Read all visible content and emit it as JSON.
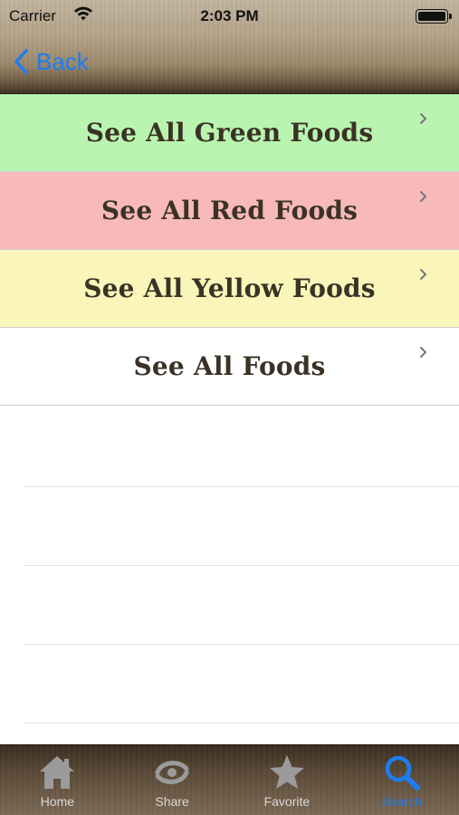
{
  "status_bar": {
    "carrier": "Carrier",
    "time": "2:03 PM"
  },
  "nav": {
    "back_label": "Back"
  },
  "list": {
    "items": [
      {
        "label": "See All Green Foods",
        "color": "#b9f5b0"
      },
      {
        "label": "See All Red Foods",
        "color": "#f7b9b9"
      },
      {
        "label": "See All Yellow Foods",
        "color": "#faf6ba"
      },
      {
        "label": "See All Foods",
        "color": "#ffffff"
      }
    ]
  },
  "tabbar": {
    "tabs": [
      {
        "label": "Home",
        "icon": "home-icon"
      },
      {
        "label": "Share",
        "icon": "share-icon"
      },
      {
        "label": "Favorite",
        "icon": "star-icon"
      },
      {
        "label": "Search",
        "icon": "search-icon",
        "active": true
      }
    ],
    "active_color": "#1e7cf2"
  }
}
